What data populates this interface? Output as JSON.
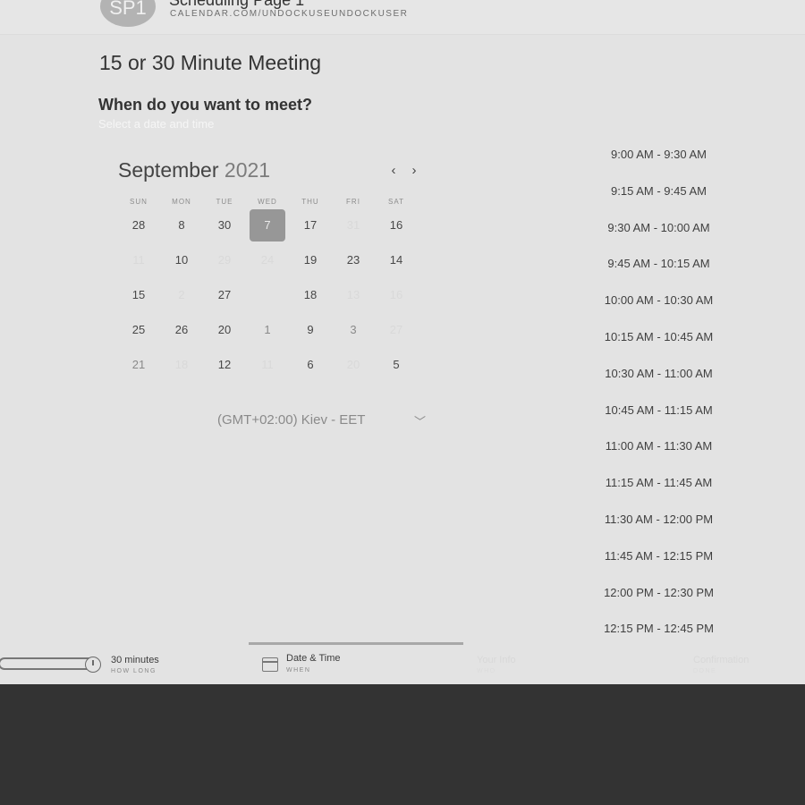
{
  "header": {
    "avatar_initials": "SP1",
    "page_name": "Scheduling Page 1",
    "url": "CALENDAR.COM/UNDOCKUSEUNDOCKUSER"
  },
  "meeting": {
    "title": "15 or 30 Minute Meeting",
    "question": "When do you want to meet?",
    "instruction": "Select a date and time"
  },
  "calendar": {
    "month": "September",
    "year": "2021",
    "prev_icon": "‹",
    "next_icon": "›",
    "weekdays": [
      "SUN",
      "MON",
      "TUE",
      "WED",
      "THU",
      "FRI",
      "SAT"
    ],
    "weeks": [
      [
        "28",
        "8",
        "30",
        "7",
        "17",
        "31",
        "16"
      ],
      [
        "11",
        "10",
        "29",
        "24",
        "19",
        "23",
        "14"
      ],
      [
        "15",
        "2",
        "27",
        "",
        "18",
        "13",
        "16"
      ],
      [
        "25",
        "26",
        "20",
        "1",
        "9",
        "3",
        "27"
      ],
      [
        "21",
        "18",
        "12",
        "11",
        "6",
        "20",
        "5"
      ]
    ],
    "selected": "7"
  },
  "timezone": {
    "value": "(GMT+02:00) Kiev - EET",
    "chevron": "﹀"
  },
  "time_slots": [
    "9:00 AM - 9:30 AM",
    "9:15 AM - 9:45 AM",
    "9:30 AM - 10:00 AM",
    "9:45 AM - 10:15 AM",
    "10:00 AM - 10:30 AM",
    "10:15 AM - 10:45 AM",
    "10:30 AM - 11:00 AM",
    "10:45 AM - 11:15 AM",
    "11:00 AM - 11:30 AM",
    "11:15 AM - 11:45 AM",
    "11:30 AM - 12:00 PM",
    "11:45 AM - 12:15 PM",
    "12:00 PM - 12:30 PM",
    "12:15 PM - 12:45 PM"
  ],
  "steps": [
    {
      "label": "30 minutes",
      "sub": "HOW LONG"
    },
    {
      "label": "Date & Time",
      "sub": "WHEN"
    },
    {
      "label": "Your Info",
      "sub": "WHO"
    },
    {
      "label": "Confirmation",
      "sub": "DONE"
    }
  ],
  "colors": {
    "panel_bg": "#e3e3e3",
    "page_bg": "#333333",
    "selected_day": "#979797"
  }
}
